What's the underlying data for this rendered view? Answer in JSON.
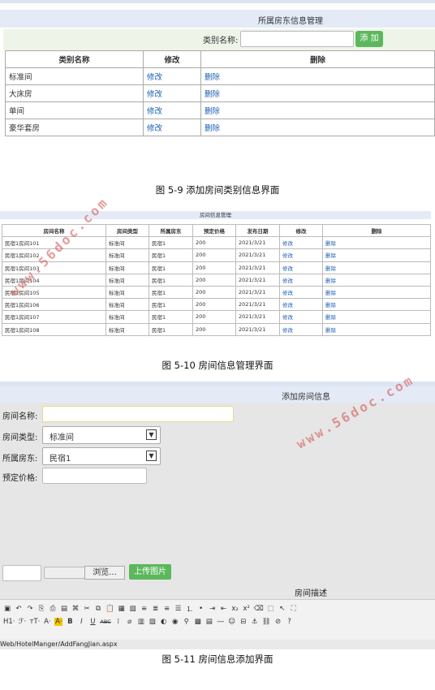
{
  "fig1": {
    "title": "所属房东信息管理",
    "search_label": "类别名称:",
    "add_button": "添 加",
    "headers": [
      "类别名称",
      "修改",
      "删除"
    ],
    "rows": [
      [
        "标准间",
        "修改",
        "删除"
      ],
      [
        "大床房",
        "修改",
        "删除"
      ],
      [
        "单间",
        "修改",
        "删除"
      ],
      [
        "豪华套房",
        "修改",
        "删除"
      ]
    ],
    "caption": "图 5-9 添加房间类别信息界面"
  },
  "fig2": {
    "title": "房间信息管理",
    "headers": [
      "房间名称",
      "房间类型",
      "所属房东",
      "预定价格",
      "发布日期",
      "修改",
      "删除"
    ],
    "rows": [
      [
        "民宿1房间101",
        "标准间",
        "民宿1",
        "200",
        "2021/3/21",
        "修改",
        "删除"
      ],
      [
        "民宿1房间102",
        "标准间",
        "民宿1",
        "200",
        "2021/3/21",
        "修改",
        "删除"
      ],
      [
        "民宿1房间103",
        "标准间",
        "民宿1",
        "200",
        "2021/3/21",
        "修改",
        "删除"
      ],
      [
        "民宿1房间104",
        "标准间",
        "民宿1",
        "200",
        "2021/3/21",
        "修改",
        "删除"
      ],
      [
        "民宿1房间105",
        "标准间",
        "民宿1",
        "200",
        "2021/3/21",
        "修改",
        "删除"
      ],
      [
        "民宿1房间106",
        "标准间",
        "民宿1",
        "200",
        "2021/3/21",
        "修改",
        "删除"
      ],
      [
        "民宿1房间107",
        "标准间",
        "民宿1",
        "200",
        "2021/3/21",
        "修改",
        "删除"
      ],
      [
        "民宿1房间108",
        "标准间",
        "民宿1",
        "200",
        "2021/3/21",
        "修改",
        "删除"
      ]
    ],
    "caption": "图 5-10 房间信息管理界面"
  },
  "fig3": {
    "title": "添加房间信息",
    "name_label": "房间名称:",
    "type_label": "房间类型:",
    "type_value": "标准间",
    "owner_label": "所属房东:",
    "owner_value": "民宿1",
    "price_label": "预定价格:",
    "browse_button": "浏览...",
    "upload_button": "上传图片",
    "desc_label": "房间描述",
    "toolbar_row2_labels": [
      "H1·",
      "ℱ·",
      "тT·",
      "A·",
      "A·",
      "B",
      "I",
      "U",
      "ABC"
    ],
    "status_url": "Web/HotelManger/AddFangJian.aspx",
    "caption": "图 5-11 房间信息添加界面"
  },
  "watermark": "www.56doc.com",
  "colors": {
    "header_bg": "#e4ebf7",
    "add_button": "#5cb85c",
    "link": "#1a5fb4",
    "watermark": "#d54a4a"
  }
}
